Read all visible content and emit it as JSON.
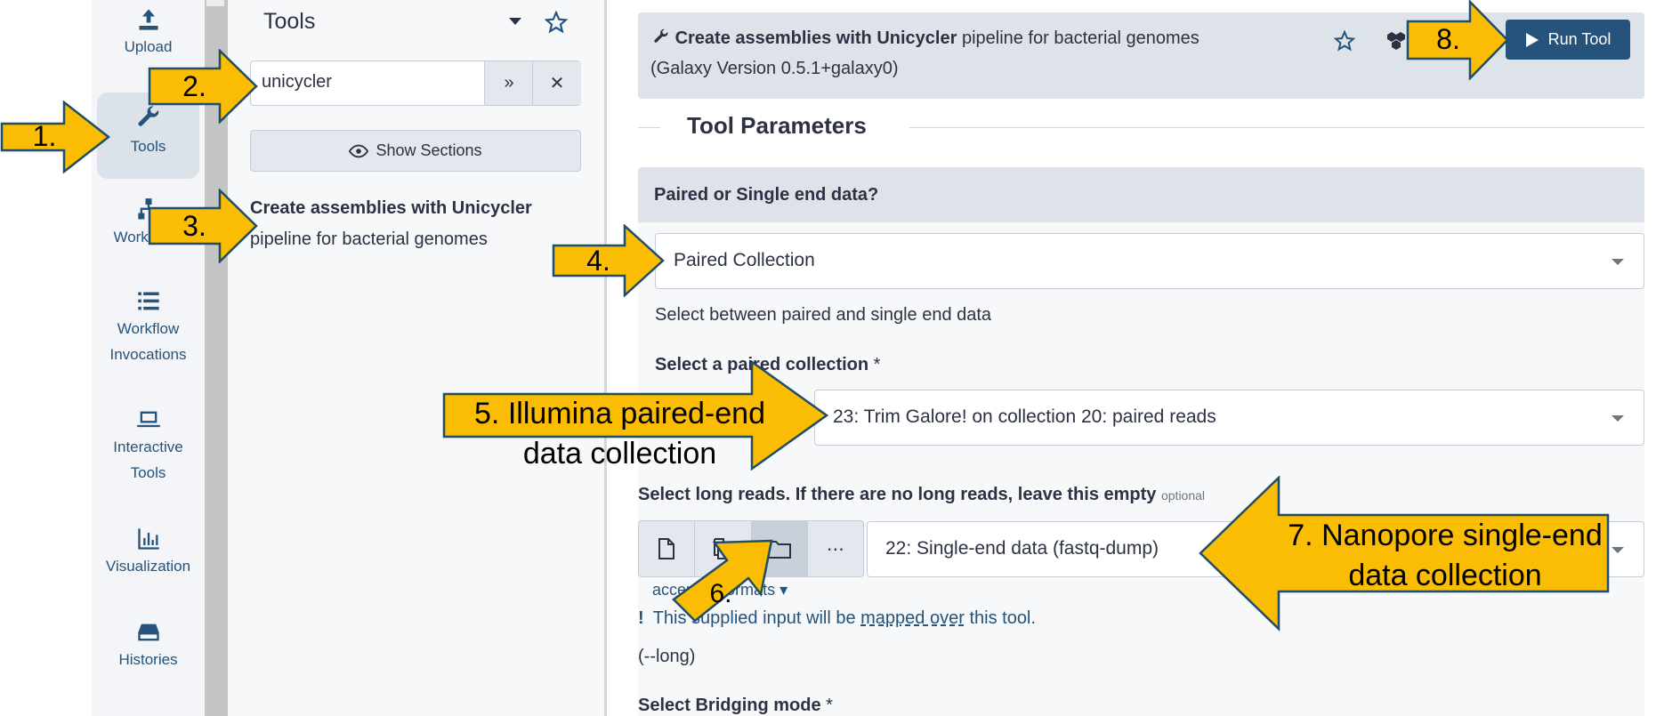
{
  "activity_bar": {
    "items": [
      {
        "label": "Upload",
        "icon": "upload-icon"
      },
      {
        "label": "Tools",
        "icon": "wrench-icon"
      },
      {
        "label": "Workflows",
        "icon": "sitemap-icon"
      },
      {
        "label": "Workflow Invocations",
        "icon": "list-icon"
      },
      {
        "label": "Interactive Tools",
        "icon": "laptop-icon"
      },
      {
        "label": "Visualization",
        "icon": "chart-icon"
      },
      {
        "label": "Histories",
        "icon": "hdd-icon"
      }
    ],
    "active": "Tools"
  },
  "tool_panel": {
    "title": "Tools",
    "search_value": "unicycler",
    "show_sections_label": "Show Sections",
    "result": {
      "bold": "Create assemblies with Unicycler",
      "rest": "pipeline for bacterial genomes"
    }
  },
  "tool_form": {
    "header": {
      "bold": "Create assemblies with Unicycler",
      "rest": "pipeline for bacterial genomes",
      "version": "(Galaxy Version 0.5.1+galaxy0)",
      "run_label": "Run Tool"
    },
    "section_title": "Tool Parameters",
    "paired_or_single": {
      "label": "Paired or Single end data?",
      "value": "Paired Collection",
      "help": "Select between paired and single end data"
    },
    "paired_collection": {
      "label": "Select a paired collection",
      "required": "*",
      "value": "23: Trim Galore! on collection 20: paired reads"
    },
    "long_reads": {
      "label": "Select long reads. If there are no long reads, leave this empty",
      "optional": "optional",
      "value": "22: Single-end data (fastq-dump)",
      "accepted_formats": "accepted formats",
      "mapped_pre": "This supplied input will be",
      "mapped_link": "mapped over",
      "mapped_post": "this tool.",
      "arg": "(--long)"
    },
    "bridging": {
      "label": "Select Bridging mode",
      "required": "*"
    }
  },
  "annotations": [
    {
      "label": "1."
    },
    {
      "label": "2."
    },
    {
      "label": "3."
    },
    {
      "label": "4."
    },
    {
      "label": "5. Illumina paired-end data collection"
    },
    {
      "label": "6."
    },
    {
      "label": "7. Nanopore single-end data collection"
    },
    {
      "label": "8."
    }
  ],
  "colors": {
    "arrow_fill": "#fbbc04",
    "arrow_stroke": "#1f4e66",
    "accent": "#25537b"
  }
}
